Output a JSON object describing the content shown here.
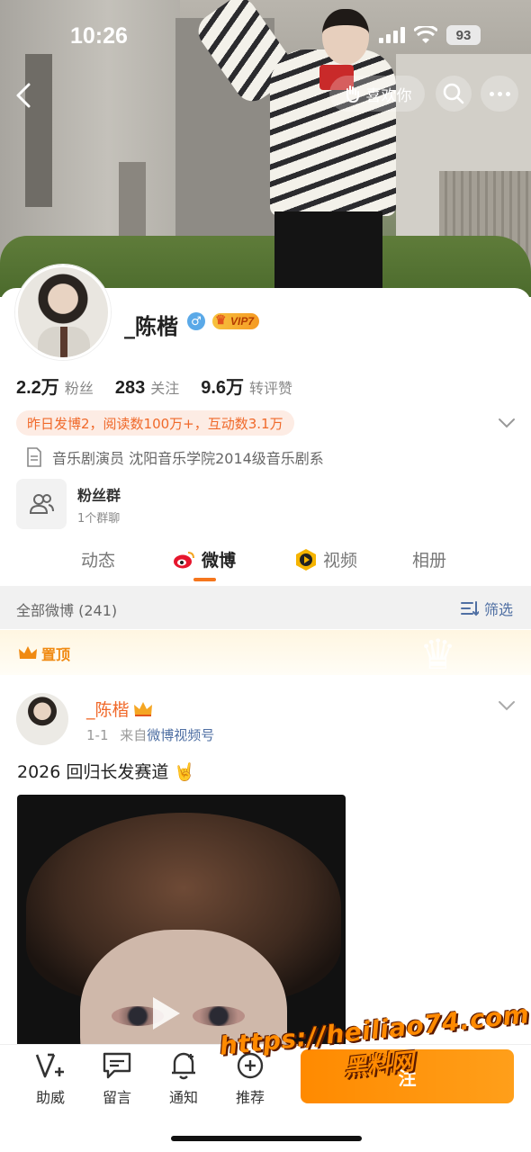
{
  "status_bar": {
    "time": "10:26",
    "battery": "93"
  },
  "top_nav": {
    "like_label": "喜欢你"
  },
  "profile": {
    "name": "_陈楷",
    "gender_symbol": "♂",
    "vip_label": "VIP7",
    "stats": [
      {
        "value": "2.2万",
        "label": "粉丝"
      },
      {
        "value": "283",
        "label": "关注"
      },
      {
        "value": "9.6万",
        "label": "转评赞"
      }
    ],
    "activity": "昨日发博2，阅读数100万+，互动数3.1万",
    "bio": "音乐剧演员 沈阳音乐学院2014级音乐剧系",
    "fan_group": {
      "title": "粉丝群",
      "subtitle": "1个群聊"
    }
  },
  "tabs": [
    {
      "label": "动态",
      "active": false
    },
    {
      "label": "微博",
      "active": true
    },
    {
      "label": "视频",
      "active": false
    },
    {
      "label": "相册",
      "active": false
    }
  ],
  "feed": {
    "count_label": "全部微博 (241)",
    "filter_label": "筛选",
    "pinned_label": "置顶",
    "post": {
      "author": "_陈楷",
      "date": "1-1",
      "source_prefix": "来自",
      "source": "微博视频号",
      "text": "2026 回归长发赛道 🤘"
    }
  },
  "bottom_bar": {
    "items": [
      {
        "label": "助威",
        "icon": "cheer-v-icon"
      },
      {
        "label": "留言",
        "icon": "message-icon"
      },
      {
        "label": "通知",
        "icon": "bell-icon"
      },
      {
        "label": "推荐",
        "icon": "recommend-icon"
      }
    ],
    "follow_label": "注"
  },
  "watermark": {
    "url": "https://heiliao74.com",
    "text": "黑料网"
  },
  "colors": {
    "accent": "#f5761d",
    "link": "#4f6fa3",
    "follow": "#ff8a00",
    "activity_bg": "#fdece4"
  }
}
